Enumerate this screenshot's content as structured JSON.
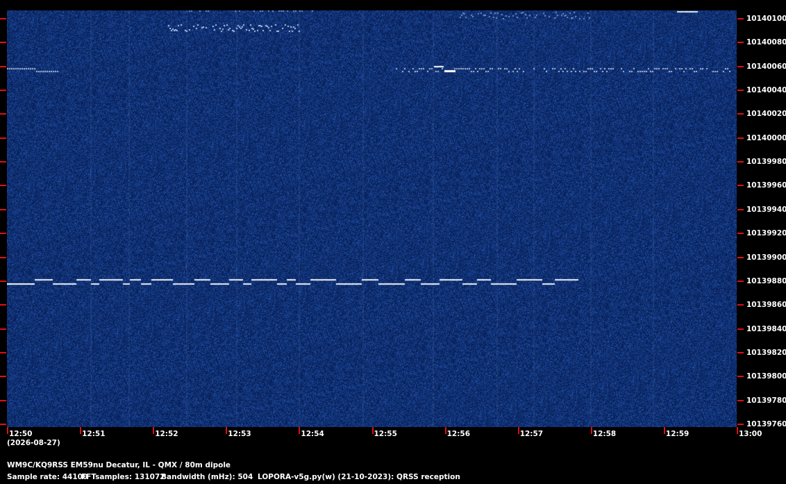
{
  "spectrogram": {
    "y_labels": [
      "10140100",
      "10140080",
      "10140060",
      "10140040",
      "10140020",
      "10140000",
      "10139980",
      "10139960",
      "10139940",
      "10139920",
      "10139900",
      "10139880",
      "10139860",
      "10139840",
      "10139820",
      "10139800",
      "10139780",
      "10139760"
    ],
    "x_labels": [
      "12:50",
      "12:51",
      "12:52",
      "12:53",
      "12:54",
      "12:55",
      "12:56",
      "12:57",
      "12:58",
      "12:59",
      "13:00"
    ],
    "date": "(2026-08-27)",
    "colors": {
      "background": "#0b2a5c",
      "signal": "#ffffff",
      "tick": "#e01010"
    }
  },
  "info": {
    "station": "WM9C/KQ9RSS EM59nu Decatur, IL - QMX / 80m dipole",
    "sample_rate": "Sample rate: 44100",
    "fft_samples": "FFTsamples: 131072",
    "bandwidth": "Bandwidth (mHz): 504",
    "software": "LOPORA-v5g.py(w) (21-10-2023): QRSS reception"
  }
}
